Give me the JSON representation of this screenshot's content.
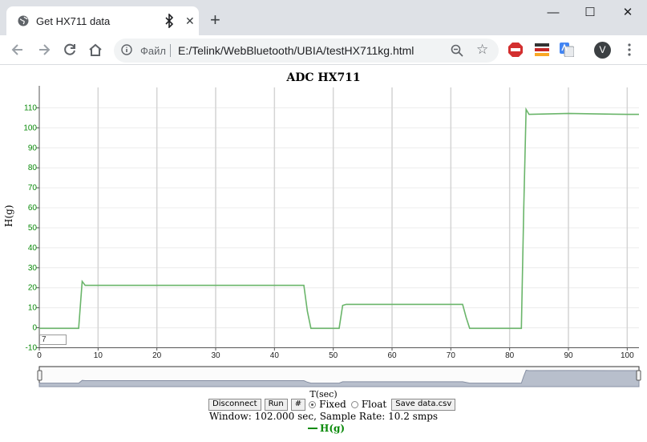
{
  "browser": {
    "tab_title": "Get HX711 data",
    "close_glyph": "✕",
    "new_tab_glyph": "+",
    "minimize_glyph": "—",
    "maximize_glyph": "☐",
    "window_close_glyph": "✕",
    "protocol_label": "Файл",
    "url": "E:/Telink/WebBluetooth/UBIA/testHX711kg.html",
    "avatar_letter": "V",
    "star_glyph": "☆",
    "icons": [
      "globe-icon",
      "bluetooth-icon",
      "back-icon",
      "forward-icon",
      "reload-icon",
      "home-icon",
      "info-icon",
      "zoom-out-icon",
      "star-icon",
      "adblock-icon",
      "extension-flag-icon",
      "translate-icon",
      "menu-icon"
    ]
  },
  "chart": {
    "title": "ADC HX711",
    "ylabel": "H(g)",
    "xlabel": "T(sec)",
    "y_input_value": "7",
    "status": "Window: 102.000 sec, Sample Rate: 10.2 smps",
    "legend": "H(g)"
  },
  "controls": {
    "disconnect": "Disconnect",
    "run": "Run",
    "hash": "#",
    "fixed": "Fixed",
    "float": "Float",
    "save": "Save data.csv",
    "mode_selected": "Fixed"
  },
  "colors": {
    "line": "#6ab56a",
    "tick_text": "#0a8a0a",
    "grid": "#d4d4d4"
  },
  "chart_data": {
    "type": "line",
    "title": "ADC HX711",
    "xlabel": "T(sec)",
    "ylabel": "H(g)",
    "xlim": [
      0,
      102
    ],
    "ylim": [
      -10,
      120
    ],
    "x_ticks": [
      0,
      10,
      20,
      30,
      40,
      50,
      60,
      70,
      80,
      90,
      100
    ],
    "y_ticks": [
      -10,
      0,
      10,
      20,
      30,
      40,
      50,
      60,
      70,
      80,
      90,
      100,
      110
    ],
    "grid": true,
    "series": [
      {
        "name": "H(g)",
        "x": [
          0,
          6.7,
          7.3,
          7.8,
          45.0,
          45.6,
          46.2,
          51.0,
          51.6,
          52.2,
          72.0,
          72.6,
          73.2,
          82.0,
          82.4,
          82.8,
          83.3,
          90,
          100,
          102
        ],
        "y": [
          -0.5,
          -0.5,
          23,
          21,
          21,
          8,
          -0.5,
          -0.5,
          11,
          11.5,
          11.5,
          5,
          -0.5,
          -0.5,
          60,
          109,
          106.5,
          107,
          106.5,
          106.5
        ]
      }
    ]
  }
}
